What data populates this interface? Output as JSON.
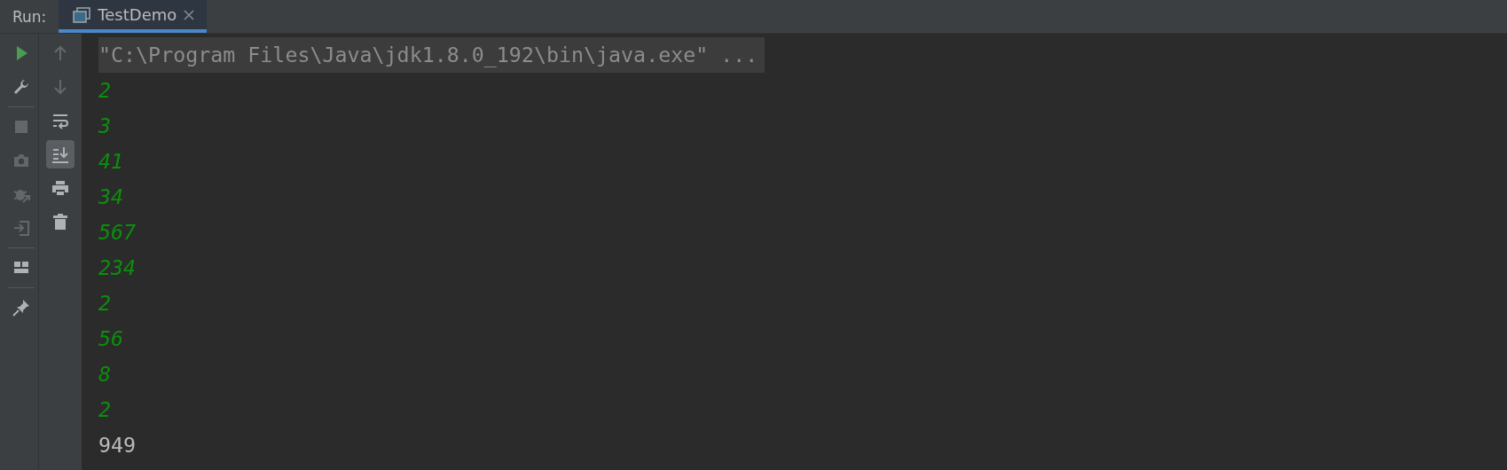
{
  "run_label": "Run:",
  "tabs": [
    {
      "title": "TestDemo",
      "selected": true,
      "closable": true
    }
  ],
  "main_toolbar": [
    {
      "kind": "run",
      "disabled": false
    },
    {
      "kind": "wrench",
      "disabled": false
    },
    {
      "kind": "divider"
    },
    {
      "kind": "stop",
      "disabled": true
    },
    {
      "kind": "camera",
      "disabled": true
    },
    {
      "kind": "bug",
      "disabled": true
    },
    {
      "kind": "exit",
      "disabled": true
    },
    {
      "kind": "divider"
    },
    {
      "kind": "layout",
      "disabled": false
    },
    {
      "kind": "divider"
    },
    {
      "kind": "pin",
      "disabled": false
    }
  ],
  "console_toolbar": [
    {
      "kind": "up",
      "disabled": true,
      "on": false
    },
    {
      "kind": "down",
      "disabled": true,
      "on": false
    },
    {
      "kind": "wrap",
      "disabled": false,
      "on": false
    },
    {
      "kind": "scroll-end",
      "disabled": false,
      "on": true
    },
    {
      "kind": "print",
      "disabled": false,
      "on": false
    },
    {
      "kind": "trash",
      "disabled": false,
      "on": false
    }
  ],
  "console_lines": [
    {
      "kind": "command",
      "text": "\"C:\\Program Files\\Java\\jdk1.8.0_192\\bin\\java.exe\" ..."
    },
    {
      "kind": "stdout",
      "text": "2"
    },
    {
      "kind": "stdout",
      "text": "3"
    },
    {
      "kind": "stdout",
      "text": "41"
    },
    {
      "kind": "stdout",
      "text": "34"
    },
    {
      "kind": "stdout",
      "text": "567"
    },
    {
      "kind": "stdout",
      "text": "234"
    },
    {
      "kind": "stdout",
      "text": "2"
    },
    {
      "kind": "stdout",
      "text": "56"
    },
    {
      "kind": "stdout",
      "text": "8"
    },
    {
      "kind": "stdout",
      "text": "2"
    },
    {
      "kind": "result",
      "text": "949"
    }
  ]
}
